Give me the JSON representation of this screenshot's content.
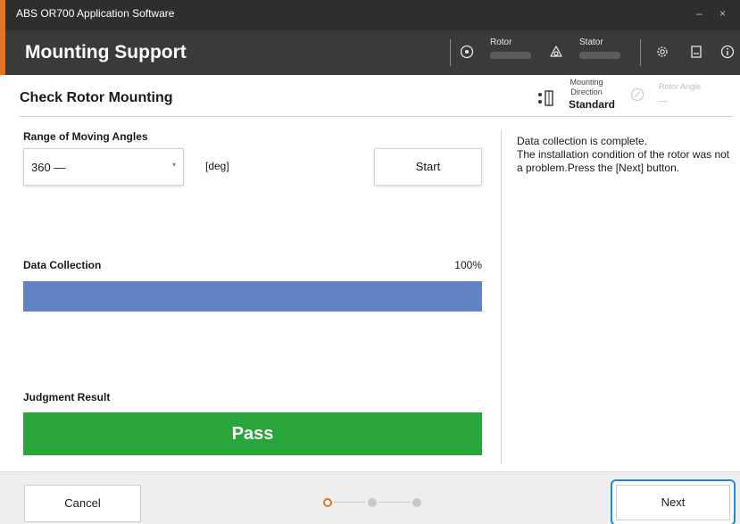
{
  "window": {
    "title": "ABS OR700 Application Software",
    "controls": "– ×"
  },
  "header": {
    "title": "Mounting Support",
    "rotor_label": "Rotor",
    "stator_label": "Stator"
  },
  "section": {
    "title": "Check Rotor Mounting",
    "mounting_direction_label": "Mounting Direction",
    "mounting_direction_value": "Standard",
    "rotor_angle_label": "Rotor Angle",
    "rotor_angle_value": "—"
  },
  "range": {
    "label": "Range of Moving Angles",
    "value": "360 —",
    "unit": "[deg]",
    "start_label": "Start"
  },
  "data_collection": {
    "label": "Data Collection",
    "percent_text": "100%",
    "progress": 1.0
  },
  "judgment": {
    "label": "Judgment Result",
    "value": "Pass"
  },
  "message": "Data collection is complete.\nThe installation condition of the rotor was not a problem.Press the [Next] button.",
  "footer": {
    "cancel_label": "Cancel",
    "next_label": "Next",
    "steps_total": 3,
    "current_step": 1
  },
  "colors": {
    "accent": "#e8731e",
    "progress": "#6384c4",
    "pass": "#2aa53c",
    "focus": "#1b8fd6"
  },
  "icons": [
    "rotor-icon",
    "stator-icon",
    "settings-icon",
    "document-icon",
    "info-icon",
    "mounting-direction-icon",
    "rotor-angle-icon",
    "chevron-down-icon"
  ]
}
